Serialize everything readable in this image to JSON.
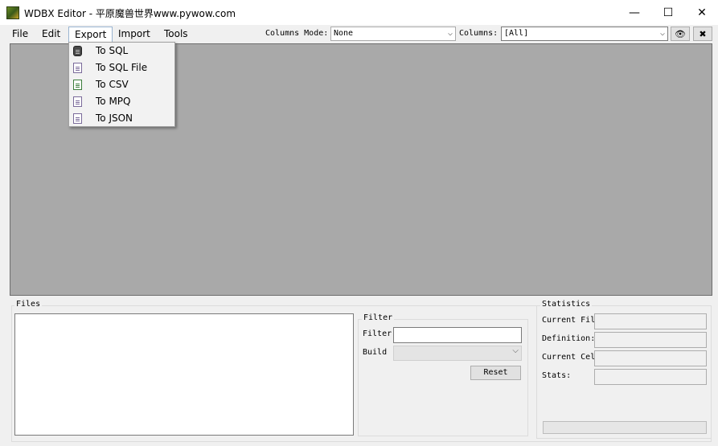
{
  "window": {
    "title": "WDBX Editor - 平原魔兽世界www.pywow.com",
    "minimize": "—",
    "maximize": "☐",
    "close": "✕"
  },
  "menu": {
    "items": [
      "File",
      "Edit",
      "Export",
      "Import",
      "Tools"
    ],
    "active": "Export"
  },
  "toolbar": {
    "columns_mode_label": "Columns Mode:",
    "columns_mode_value": "None",
    "columns_label": "Columns:",
    "columns_value": "[All]",
    "arrow": "⌵",
    "eye_icon": "eye-slash-icon",
    "eye_glyph": "👁",
    "clear_icon": "close-icon",
    "clear_glyph": "✖"
  },
  "export_menu": {
    "items": [
      {
        "label": "To SQL",
        "icon": "database-icon"
      },
      {
        "label": "To SQL File",
        "icon": "document-icon"
      },
      {
        "label": "To CSV",
        "icon": "csv-file-icon"
      },
      {
        "label": "To MPQ",
        "icon": "document-icon"
      },
      {
        "label": "To JSON",
        "icon": "document-icon"
      }
    ]
  },
  "files": {
    "title": "Files"
  },
  "filter": {
    "title": "Filter",
    "filter_label": "Filter",
    "filter_value": "",
    "build_label": "Build",
    "build_value": "",
    "reset_label": "Reset"
  },
  "statistics": {
    "title": "Statistics",
    "current_file_label": "Current Fil",
    "definition_label": "Definition:",
    "current_cell_label": "Current Cel",
    "stats_label": "Stats:",
    "current_file_value": "",
    "definition_value": "",
    "current_cell_value": "",
    "stats_value": "",
    "progress": 0
  }
}
